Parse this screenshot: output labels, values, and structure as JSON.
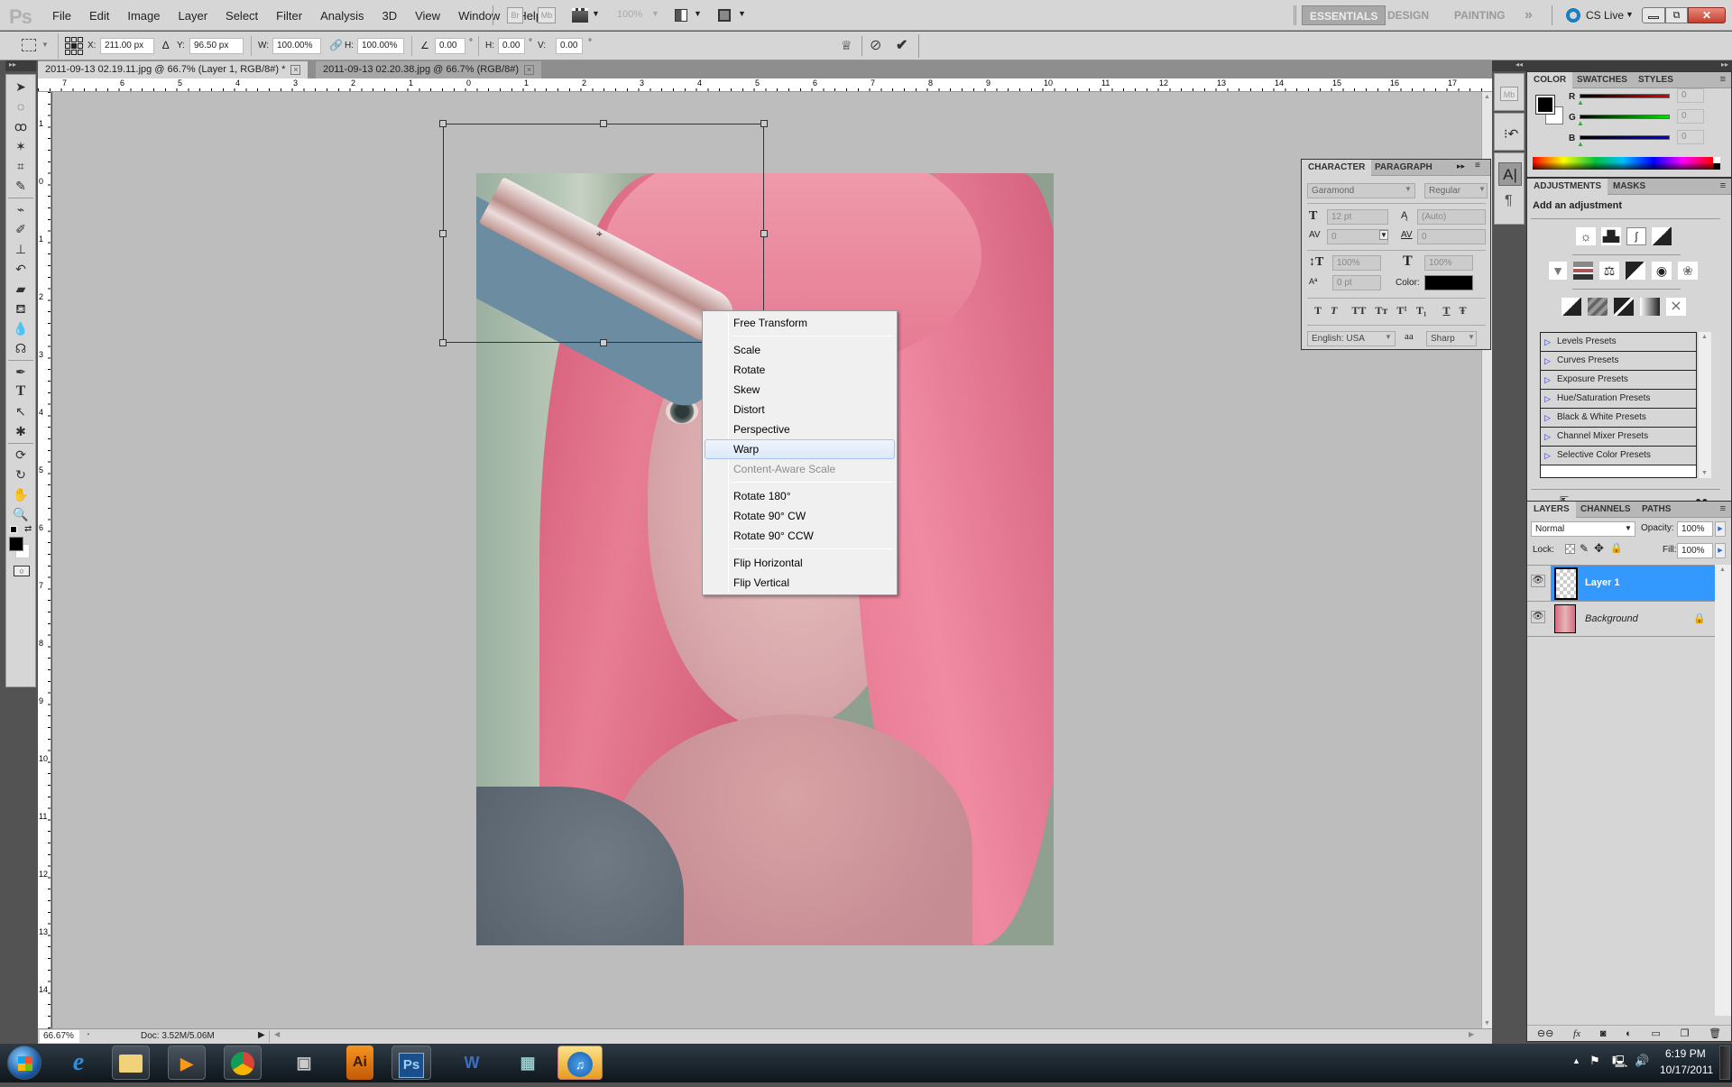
{
  "app": {
    "logo": "Ps"
  },
  "menubar": {
    "items": [
      "File",
      "Edit",
      "Image",
      "Layer",
      "Select",
      "Filter",
      "Analysis",
      "3D",
      "View",
      "Window",
      "Help"
    ],
    "bridge_label": "Br",
    "minibridge_label": "Mb",
    "zoom_value": "100%",
    "workspaces": [
      "ESSENTIALS",
      "DESIGN",
      "PAINTING"
    ],
    "workspace_more": "»",
    "cs_live": "CS Live"
  },
  "options": {
    "x_label": "X:",
    "x_value": "211.00 px",
    "y_label": "Y:",
    "y_value": "96.50 px",
    "w_label": "W:",
    "w_value": "100.00%",
    "h_label": "H:",
    "h_value": "100.00%",
    "angle_value": "0.00",
    "hskew_label": "H:",
    "hskew_value": "0.00",
    "vskew_label": "V:",
    "vskew_value": "0.00",
    "degree": "°"
  },
  "doc_tabs": [
    {
      "label": "2011-09-13 02.19.11.jpg @ 66.7% (Layer 1, RGB/8#) *",
      "active": true
    },
    {
      "label": "2011-09-13 02.20.38.jpg @ 66.7% (RGB/8#)",
      "active": false
    }
  ],
  "ruler_top": [
    "7",
    "6",
    "5",
    "4",
    "3",
    "2",
    "1",
    "0",
    "1",
    "2",
    "3",
    "4",
    "5",
    "6",
    "7",
    "8",
    "9",
    "10",
    "11",
    "12",
    "13",
    "14",
    "15",
    "16",
    "17"
  ],
  "ruler_left": [
    "1",
    "0",
    "1",
    "2",
    "3",
    "4",
    "5",
    "6",
    "7",
    "8",
    "9",
    "10",
    "11",
    "12",
    "13",
    "14"
  ],
  "context_menu": {
    "items": [
      {
        "label": "Free Transform",
        "state": "normal"
      },
      {
        "sep": true
      },
      {
        "label": "Scale",
        "state": "normal"
      },
      {
        "label": "Rotate",
        "state": "normal"
      },
      {
        "label": "Skew",
        "state": "normal"
      },
      {
        "label": "Distort",
        "state": "normal"
      },
      {
        "label": "Perspective",
        "state": "normal"
      },
      {
        "label": "Warp",
        "state": "hover"
      },
      {
        "label": "Content-Aware Scale",
        "state": "disabled"
      },
      {
        "sep": true
      },
      {
        "label": "Rotate 180°",
        "state": "normal"
      },
      {
        "label": "Rotate 90° CW",
        "state": "normal"
      },
      {
        "label": "Rotate 90° CCW",
        "state": "normal"
      },
      {
        "sep": true
      },
      {
        "label": "Flip Horizontal",
        "state": "normal"
      },
      {
        "label": "Flip Vertical",
        "state": "normal"
      }
    ]
  },
  "character_panel": {
    "tabs": [
      "CHARACTER",
      "PARAGRAPH"
    ],
    "font_family": "Garamond",
    "font_style": "Regular",
    "font_size": "12 pt",
    "leading": "(Auto)",
    "kerning": "0",
    "tracking": "0",
    "vscale": "100%",
    "hscale": "100%",
    "baseline": "0 pt",
    "color_label": "Color:",
    "color": "#000000",
    "style_buttons": [
      "T",
      "T",
      "TT",
      "Tт",
      "T¹",
      "T₁",
      "T",
      "Ŧ"
    ],
    "language": "English: USA",
    "aa_icon": "aa",
    "antialias": "Sharp"
  },
  "color_panel": {
    "tabs": [
      "COLOR",
      "SWATCHES",
      "STYLES"
    ],
    "channels": [
      {
        "label": "R",
        "value": "0",
        "color": "#e00000"
      },
      {
        "label": "G",
        "value": "0",
        "color": "#00e000"
      },
      {
        "label": "B",
        "value": "0",
        "color": "#0000e0"
      }
    ],
    "foreground": "#000000",
    "background": "#ffffff"
  },
  "adjustments_panel": {
    "tabs": [
      "ADJUSTMENTS",
      "MASKS"
    ],
    "heading": "Add an adjustment",
    "presets": [
      "Levels Presets",
      "Curves Presets",
      "Exposure Presets",
      "Hue/Saturation Presets",
      "Black & White Presets",
      "Channel Mixer Presets",
      "Selective Color Presets"
    ]
  },
  "layers_panel": {
    "tabs": [
      "LAYERS",
      "CHANNELS",
      "PATHS"
    ],
    "blend_mode": "Normal",
    "opacity_label": "Opacity:",
    "opacity": "100%",
    "lock_label": "Lock:",
    "fill_label": "Fill:",
    "fill": "100%",
    "layers": [
      {
        "name": "Layer 1",
        "selected": true,
        "visible": true
      },
      {
        "name": "Background",
        "selected": false,
        "visible": true,
        "locked": true
      }
    ]
  },
  "status": {
    "zoom": "66.67%",
    "doc": "Doc: 3.52M/5.06M"
  },
  "taskbar": {
    "apps": [
      "Start",
      "Internet Explorer",
      "Windows Explorer",
      "Windows Media Player",
      "Google Chrome",
      "Camera App",
      "Illustrator",
      "Photoshop",
      "Word",
      "Calculator",
      "iTunes"
    ],
    "ai_label": "Ai",
    "ps_label": "Ps",
    "time": "6:19 PM",
    "date": "10/17/2011"
  },
  "accent": {
    "selection_blue": "#3399ff",
    "menu_hover": "#dde9f8"
  }
}
